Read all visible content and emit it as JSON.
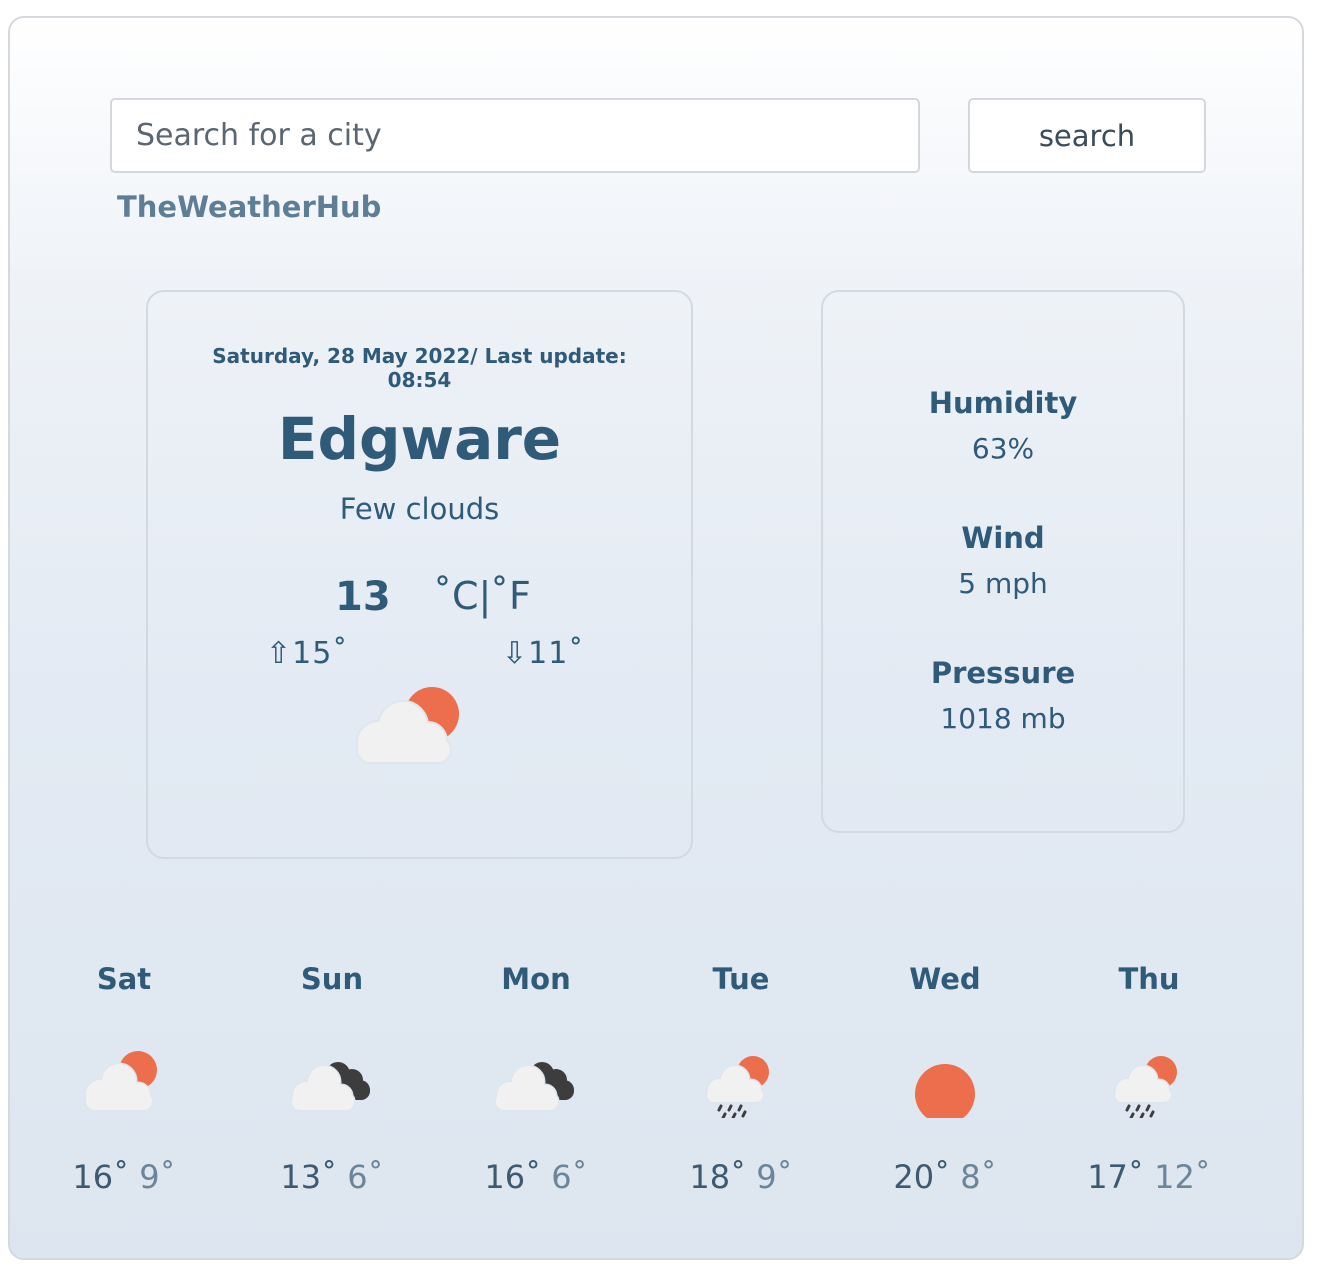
{
  "search": {
    "placeholder": "Search for a city",
    "button_label": "search"
  },
  "brand": "TheWeatherHub",
  "current": {
    "date_line": "Saturday, 28 May 2022/ Last update:",
    "time": "08:54",
    "city": "Edgware",
    "description": "Few clouds",
    "temperature": "13",
    "unit_celsius": "˚C|",
    "unit_fahrenheit": "˚F",
    "high": "⇧15˚",
    "low": "⇩11˚",
    "icon": "few-clouds-day-icon"
  },
  "details": {
    "humidity_label": "Humidity",
    "humidity_value": "63%",
    "wind_label": "Wind",
    "wind_value": "5 mph",
    "pressure_label": "Pressure",
    "pressure_value": "1018 mb"
  },
  "forecast": [
    {
      "day": "Sat",
      "max": "16˚",
      "min": "9˚",
      "icon": "few-clouds-day-icon"
    },
    {
      "day": "Sun",
      "max": "13˚",
      "min": "6˚",
      "icon": "broken-clouds-icon"
    },
    {
      "day": "Mon",
      "max": "16˚",
      "min": "6˚",
      "icon": "broken-clouds-icon"
    },
    {
      "day": "Tue",
      "max": "18˚",
      "min": "9˚",
      "icon": "rain-day-icon"
    },
    {
      "day": "Wed",
      "max": "20˚",
      "min": "8˚",
      "icon": "clear-sky-day-icon"
    },
    {
      "day": "Thu",
      "max": "17˚",
      "min": "12˚",
      "icon": "rain-day-icon"
    }
  ],
  "colors": {
    "text_primary": "#2f5a78",
    "brand": "#5e7e96",
    "sun": "#ec6e4c",
    "cloud_light": "#f1f1f1",
    "cloud_dark": "#3d3d3d"
  }
}
